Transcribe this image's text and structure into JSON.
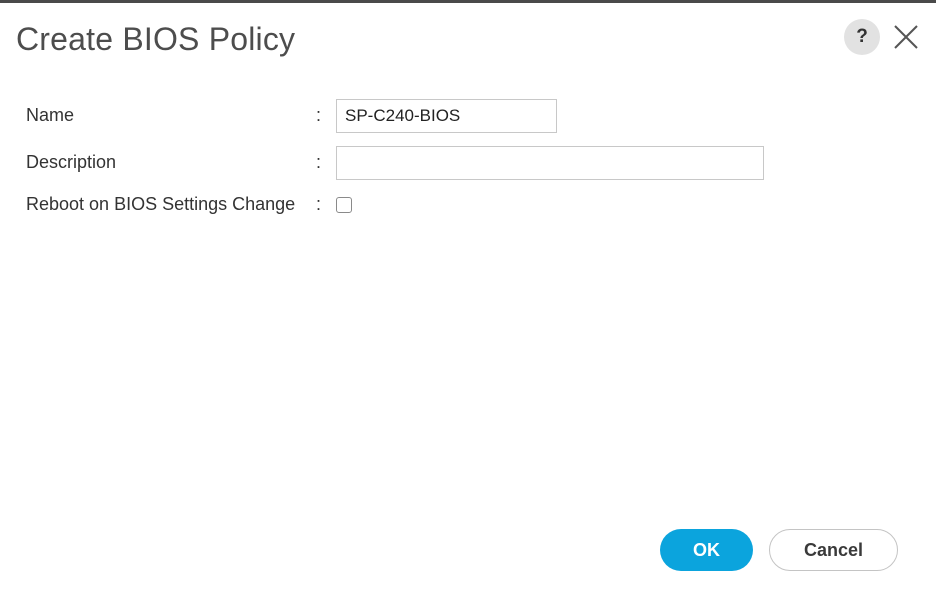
{
  "dialog": {
    "title": "Create BIOS Policy",
    "help_label": "?"
  },
  "form": {
    "name": {
      "label": "Name",
      "separator": ":",
      "value": "SP-C240-BIOS"
    },
    "description": {
      "label": "Description",
      "separator": ":",
      "value": ""
    },
    "reboot": {
      "label": "Reboot on BIOS Settings Change",
      "separator": ":",
      "checked": false
    }
  },
  "footer": {
    "ok_label": "OK",
    "cancel_label": "Cancel"
  },
  "colors": {
    "accent": "#0ba4dd",
    "title_text": "#4d4d4d",
    "border": "#c8c8c8"
  },
  "icons": {
    "help": "question-icon",
    "close": "close-icon"
  }
}
